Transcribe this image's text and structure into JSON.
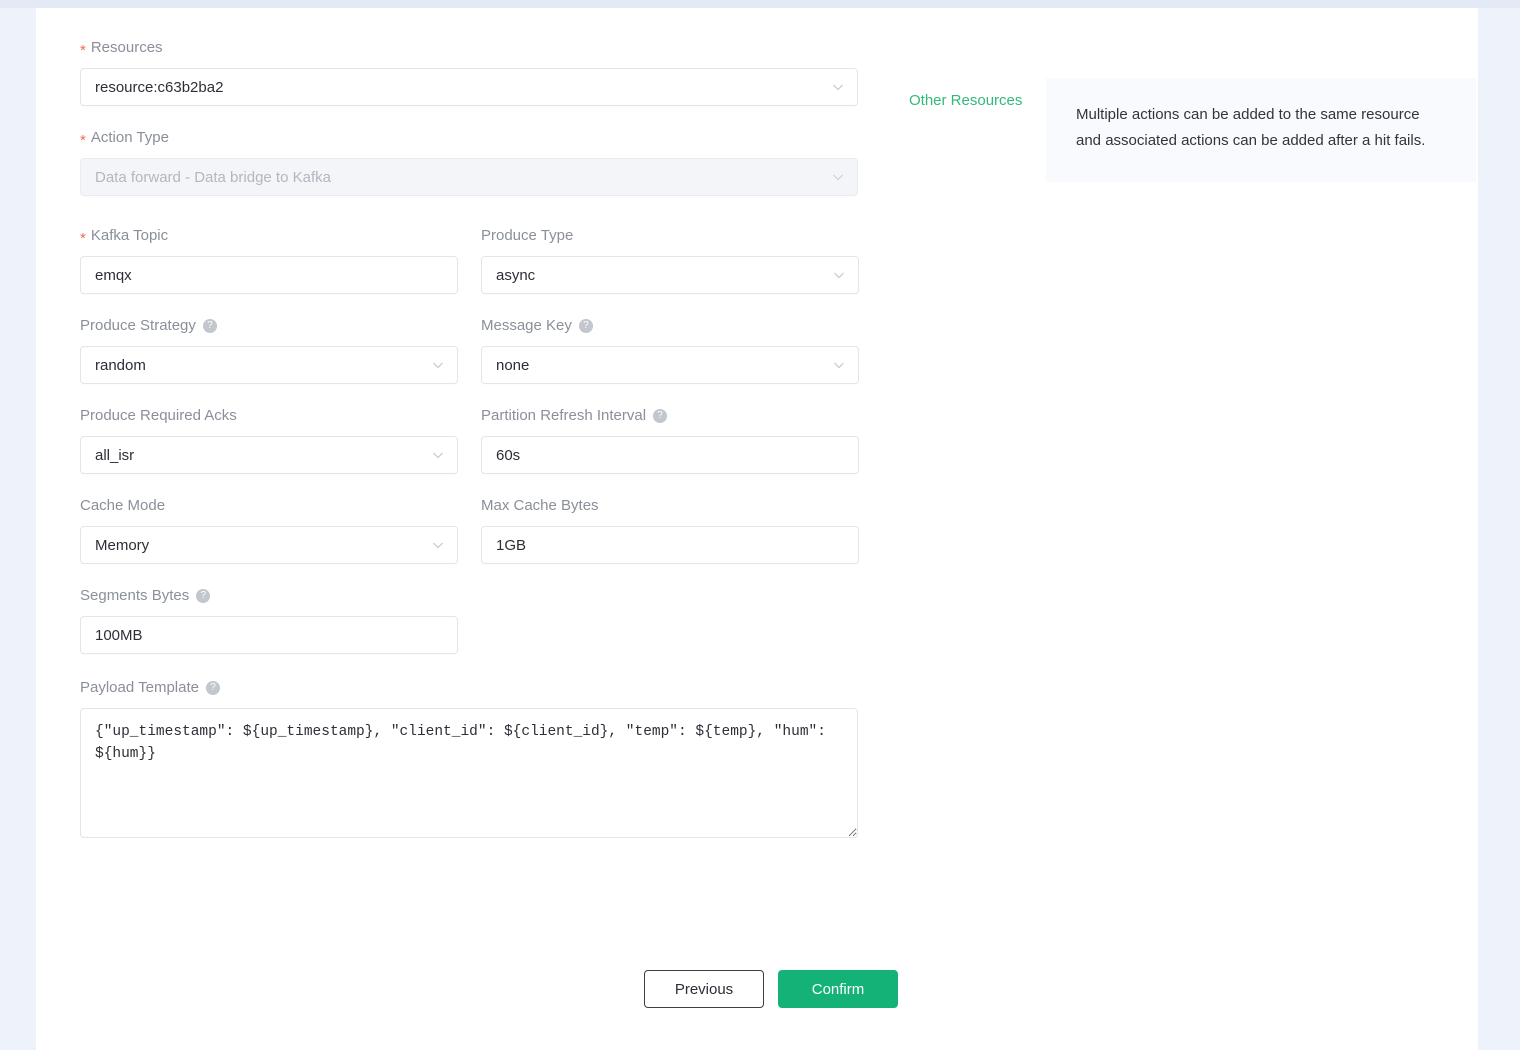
{
  "colors": {
    "accent_green": "#14b277",
    "link_green": "#33b87a",
    "required_star": "#f56a4c",
    "label_gray": "#8a8f99",
    "page_bg": "#eef2fa",
    "info_bg": "#f8fafd",
    "disabled_bg": "#f4f5f8"
  },
  "form": {
    "resources": {
      "label": "Resources",
      "required_mark": "*",
      "value": "resource:c63b2ba2",
      "chevron_icon": "chevron-down-icon"
    },
    "other_resources_link": "Other Resources",
    "action_type": {
      "label": "Action Type",
      "required_mark": "*",
      "value": "Data forward - Data bridge to Kafka",
      "disabled": true,
      "chevron_icon": "chevron-down-icon"
    },
    "kafka_topic": {
      "label": "Kafka Topic",
      "required_mark": "*",
      "value": "emqx"
    },
    "produce_type": {
      "label": "Produce Type",
      "value": "async",
      "chevron_icon": "chevron-down-icon"
    },
    "produce_strategy": {
      "label": "Produce Strategy",
      "help_icon": "question-circle-icon",
      "help_mark": "?",
      "value": "random",
      "chevron_icon": "chevron-down-icon"
    },
    "message_key": {
      "label": "Message Key",
      "help_icon": "question-circle-icon",
      "help_mark": "?",
      "value": "none",
      "chevron_icon": "chevron-down-icon"
    },
    "produce_required_acks": {
      "label": "Produce Required Acks",
      "value": "all_isr",
      "chevron_icon": "chevron-down-icon"
    },
    "partition_refresh_interval": {
      "label": "Partition Refresh Interval",
      "help_icon": "question-circle-icon",
      "help_mark": "?",
      "value": "60s"
    },
    "cache_mode": {
      "label": "Cache Mode",
      "value": "Memory",
      "chevron_icon": "chevron-down-icon"
    },
    "max_cache_bytes": {
      "label": "Max Cache Bytes",
      "value": "1GB"
    },
    "segments_bytes": {
      "label": "Segments Bytes",
      "help_icon": "question-circle-icon",
      "help_mark": "?",
      "value": "100MB"
    },
    "payload_template": {
      "label": "Payload Template",
      "help_icon": "question-circle-icon",
      "help_mark": "?",
      "value": "{\"up_timestamp\": ${up_timestamp}, \"client_id\": ${client_id}, \"temp\": ${temp}, \"hum\": ${hum}}"
    }
  },
  "info_panel": {
    "text": "Multiple actions can be added to the same resource and associated actions can be added after a hit fails."
  },
  "footer": {
    "previous_label": "Previous",
    "confirm_label": "Confirm"
  }
}
